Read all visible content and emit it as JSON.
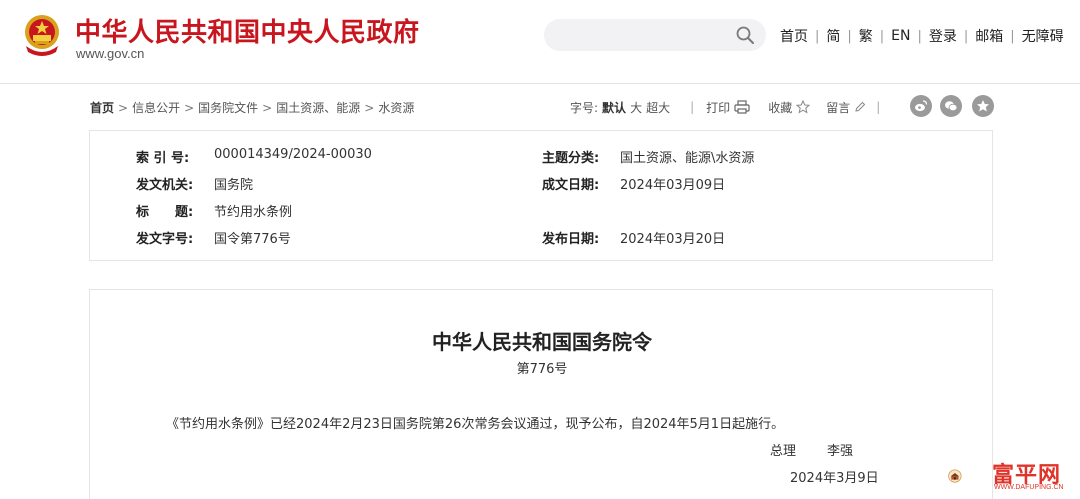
{
  "header": {
    "site_title": "中华人民共和国中央人民政府",
    "site_url": "www.gov.cn",
    "search_placeholder": "",
    "nav": [
      "首页",
      "简",
      "繁",
      "EN",
      "登录",
      "邮箱",
      "无障碍"
    ]
  },
  "breadcrumb": {
    "home": "首页",
    "items": [
      "信息公开",
      "国务院文件",
      "国土资源、能源",
      "水资源"
    ]
  },
  "tools": {
    "font_size_label": "字号:",
    "font_default": "默认",
    "font_large": "大",
    "font_xlarge": "超大",
    "print": "打印",
    "favorite": "收藏",
    "comment": "留言"
  },
  "meta": {
    "index_label": "索 引 号:",
    "index_value": "000014349/2024-00030",
    "topic_label": "主题分类:",
    "topic_value": "国土资源、能源\\水资源",
    "issuer_label": "发文机关:",
    "issuer_value": "国务院",
    "written_label": "成文日期:",
    "written_value": "2024年03月09日",
    "title_label": "标　　题:",
    "title_value": "节约用水条例",
    "docno_label": "发文字号:",
    "docno_value": "国令第776号",
    "published_label": "发布日期:",
    "published_value": "2024年03月20日"
  },
  "document": {
    "title": "中华人民共和国国务院令",
    "number": "第776号",
    "body": "《节约用水条例》已经2024年2月23日国务院第26次常务会议通过，现予公布，自2024年5月1日起施行。",
    "sign_role": "总理",
    "sign_name": "李强",
    "sign_date": "2024年3月9日"
  },
  "watermark": {
    "text": "富平网",
    "url": "WWW.DAFUPING.CN"
  },
  "colors": {
    "brand_red": "#c8161e",
    "watermark_red": "#e0342a",
    "share_gray": "#9a9a9a"
  }
}
